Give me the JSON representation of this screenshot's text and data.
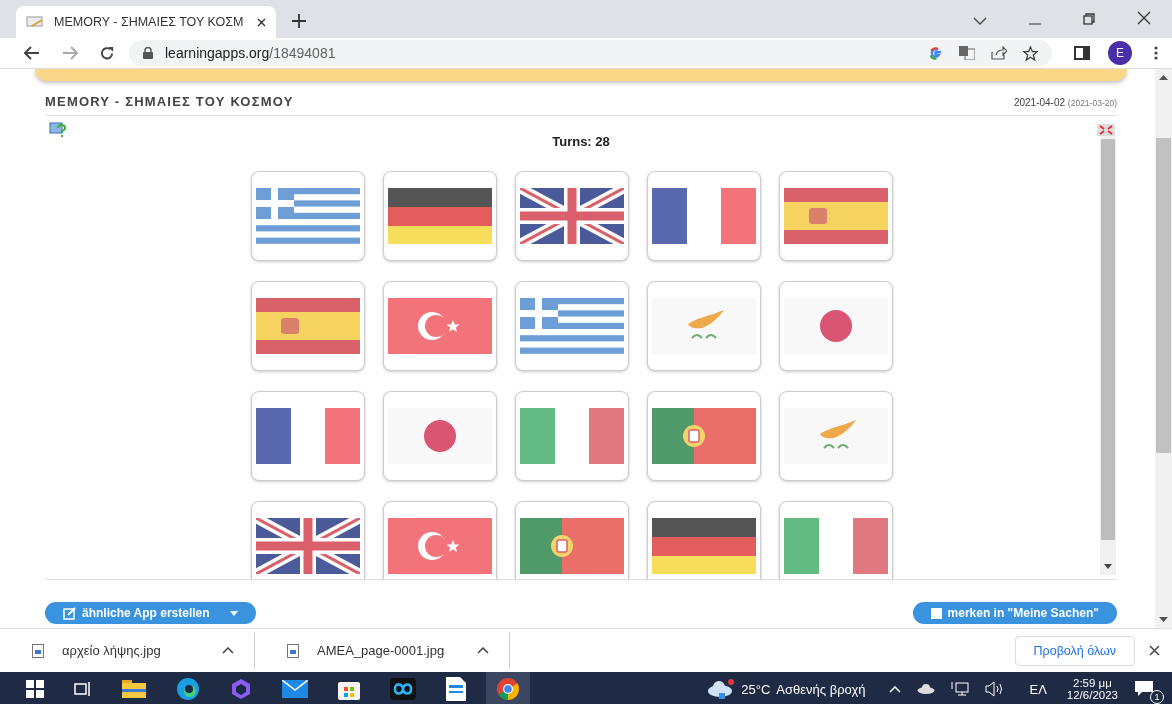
{
  "browser": {
    "tab_title": "MEMORY - ΣΗΜΑΙΕΣ ΤΟΥ ΚΟΣΜ",
    "url_domain": "learningapps.org",
    "url_path": "/18494081",
    "profile_initial": "E"
  },
  "page": {
    "title": "MEMORY - ΣΗΜΑΙΕΣ ΤΟΥ ΚΟΣΜΟΥ",
    "date": "2021-04-02",
    "date_created": "(2021-03-20)",
    "turns": "Turns: 28",
    "cards": [
      {
        "kind": "greece"
      },
      {
        "kind": "germany"
      },
      {
        "kind": "uk"
      },
      {
        "kind": "france"
      },
      {
        "kind": "spain"
      },
      {
        "kind": "spain"
      },
      {
        "kind": "turkey"
      },
      {
        "kind": "greece"
      },
      {
        "kind": "cyprus"
      },
      {
        "kind": "japan"
      },
      {
        "kind": "france"
      },
      {
        "kind": "japan"
      },
      {
        "kind": "italy"
      },
      {
        "kind": "portugal"
      },
      {
        "kind": "cyprus"
      },
      {
        "kind": "uk"
      },
      {
        "kind": "turkey"
      },
      {
        "kind": "portugal"
      },
      {
        "kind": "germany"
      },
      {
        "kind": "italy"
      }
    ],
    "buttons": [
      "ähnliche App erstellen",
      "merken in \"Meine Sachen\""
    ]
  },
  "downloads": {
    "files": [
      "αρχείο λήψης.jpg",
      "AMEA_page-0001.jpg"
    ],
    "show_all": "Προβολή όλων"
  },
  "taskbar": {
    "temperature": "25°C",
    "weather": "Ασθενής βροχή",
    "language": "ΕΛ",
    "time": "2:59 μμ",
    "date": "12/6/2023",
    "notifications": "1"
  }
}
